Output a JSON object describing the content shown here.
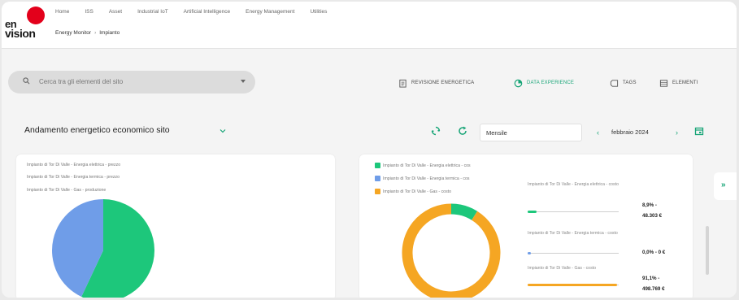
{
  "brand": {
    "line1": "en",
    "line2": "vision",
    "accent": "#e3001b"
  },
  "nav": [
    "Home",
    "ISS",
    "Asset",
    "Industrial IoT",
    "Artificial Intelligence",
    "Energy Management",
    "Utilities"
  ],
  "breadcrumb": {
    "parent": "Energy Monitor",
    "current": "Impianto"
  },
  "search": {
    "placeholder": "Cerca tra gli elementi del sito"
  },
  "actions": {
    "revisione": "REVISIONE ENERGETICA",
    "data_experience": "DATA EXPERIENCE",
    "tags": "TAGS",
    "elementi": "ELEMENTI"
  },
  "section": {
    "title": "Andamento energetico economico sito"
  },
  "period": {
    "select_value": "Mensile",
    "month": "febbraio 2024"
  },
  "left_card": {
    "legend": [
      "Impianto di Tor Di Valle - Energia elettrica - prezzo",
      "Impianto di Tor Di Valle - Energia termica - prezzo",
      "Impianto di Tor Di Valle - Gas - produzione"
    ],
    "pie": [
      {
        "value": 57,
        "color": "#1dc77b"
      },
      {
        "value": 43,
        "color": "#6f9de8"
      }
    ]
  },
  "right_card": {
    "legend": [
      {
        "label": "Impianto di Tor Di Valle - Energia elettrica - cos",
        "color": "#1dc77b"
      },
      {
        "label": "Impianto di Tor Di Valle - Energia termica - cos",
        "color": "#6f9de8"
      },
      {
        "label": "Impianto di Tor Di Valle - Gas - costo",
        "color": "#f5a623"
      }
    ],
    "donut": [
      {
        "value": 8.9,
        "color": "#1dc77b"
      },
      {
        "value": 0.0,
        "color": "#6f9de8"
      },
      {
        "value": 91.1,
        "color": "#f5a623"
      }
    ],
    "kpis": [
      {
        "desc": "Impianto di Tor Di Valle - Energia elettrica - costo",
        "pct": "8,9% -",
        "amount": "48.303 €",
        "fill": 0.1,
        "color": "#1dc77b"
      },
      {
        "desc": "Impianto di Tor Di Valle - Energia termica - costo",
        "pct": "0,0% - 0 €",
        "amount": "",
        "fill": 0.02,
        "color": "#6f9de8"
      },
      {
        "desc": "Impianto di Tor Di Valle - Gas - costo",
        "pct": "91,1% -",
        "amount": "498.769 €",
        "fill": 0.98,
        "color": "#f5a623"
      }
    ]
  }
}
